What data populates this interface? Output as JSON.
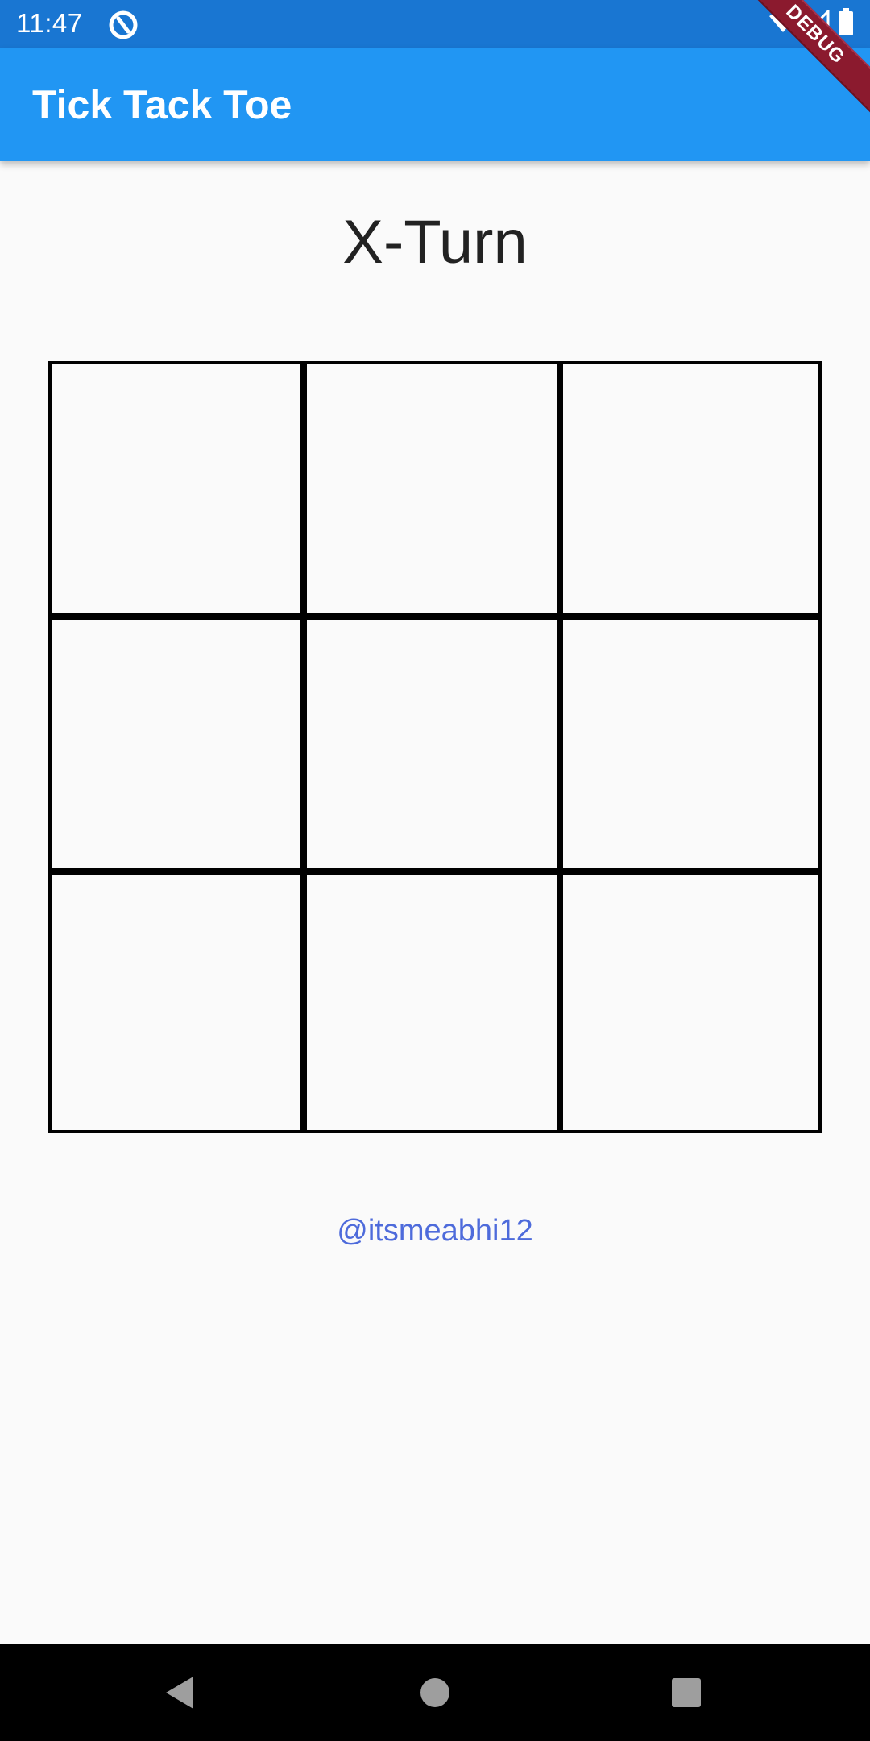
{
  "status_bar": {
    "time": "11:47",
    "icons": [
      "app-notification-icon",
      "wifi-icon",
      "signal-icon",
      "battery-icon"
    ]
  },
  "debug_banner": {
    "label": "DEBUG"
  },
  "app_bar": {
    "title": "Tick Tack Toe",
    "color": "#2196f3"
  },
  "game": {
    "turn_label": "X-Turn",
    "board": [
      "",
      "",
      "",
      "",
      "",
      "",
      "",
      "",
      ""
    ]
  },
  "footer": {
    "credit": "@itsmeabhi12",
    "credit_color": "#4e6bdb"
  },
  "nav_bar": {
    "buttons": [
      "back-icon",
      "home-icon",
      "recents-icon"
    ]
  }
}
